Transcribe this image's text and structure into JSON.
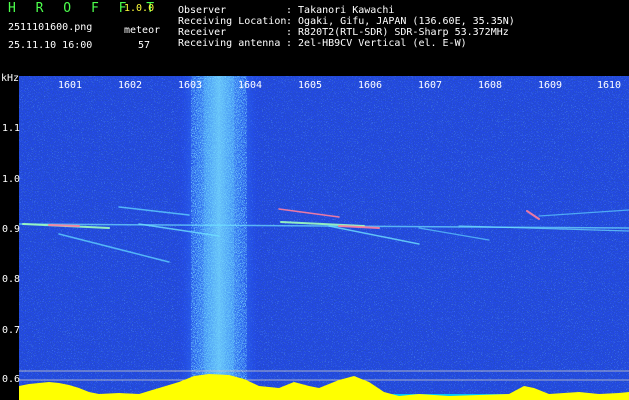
{
  "app": {
    "title": "H R O F F T",
    "version": "1.0.0",
    "filename": "2511101600.png",
    "datetime": "25.11.10 16:00",
    "meteor_label": "meteor",
    "meteor_count": "57"
  },
  "info": [
    {
      "key": "Observer",
      "value": ": Takanori Kawachi"
    },
    {
      "key": "Receiving Location",
      "value": ": Ogaki, Gifu, JAPAN (136.60E, 35.35N)"
    },
    {
      "key": "Receiver",
      "value": ": R820T2(RTL-SDR) SDR-Sharp 53.372MHz"
    },
    {
      "key": "Receiving antenna",
      "value": ": 2el-HB9CV Vertical (el. E-W)"
    }
  ],
  "axes": {
    "y_unit": "kHz",
    "y_ticks": [
      "1.1",
      "1.0",
      "0.9",
      "0.8",
      "0.7",
      "0.6"
    ],
    "x_ticks": [
      "1601",
      "1602",
      "1603",
      "1604",
      "1605",
      "1606",
      "1607",
      "1608",
      "1609",
      "1610"
    ]
  },
  "colors": {
    "background": "#000000",
    "noise": "#0a1a8a",
    "header_text": "#ffffff",
    "title_text": "#4cff4c",
    "level_bar": "#ffff00",
    "level_base": "#00c8ff"
  }
}
